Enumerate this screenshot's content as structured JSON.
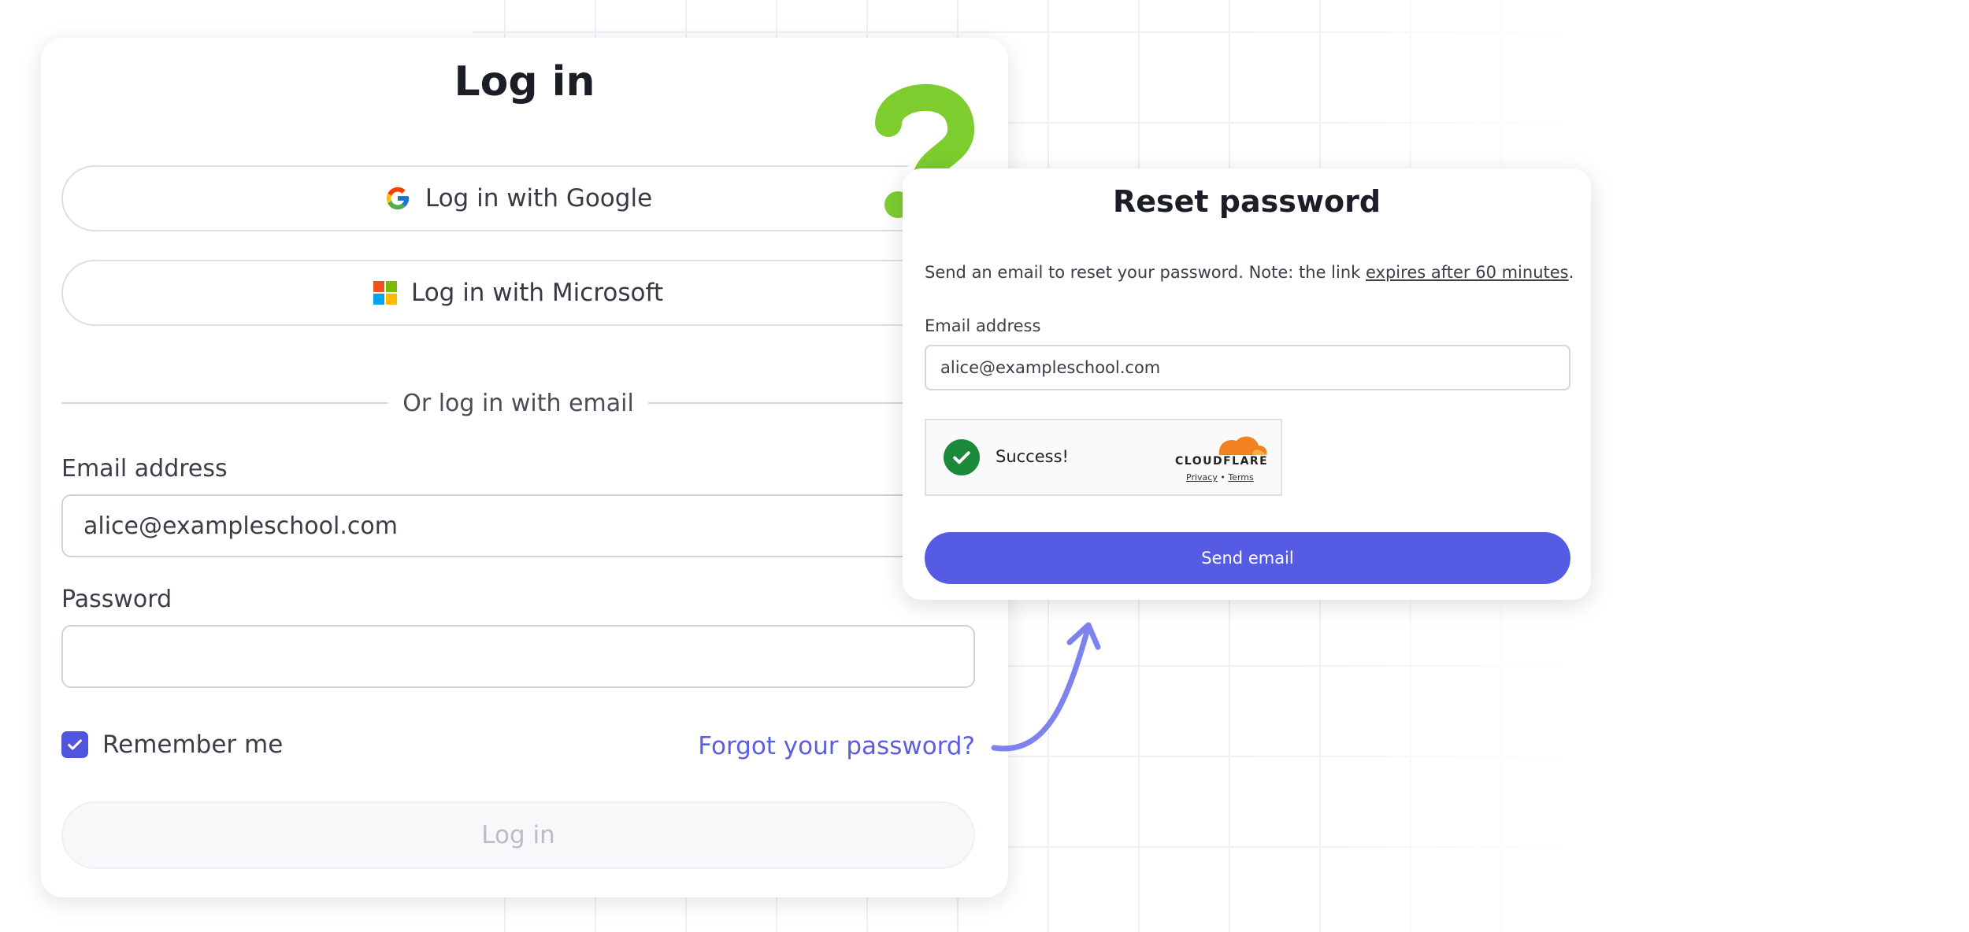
{
  "login": {
    "title": "Log in",
    "google_button": "Log in with Google",
    "microsoft_button": "Log in with Microsoft",
    "divider_text": "Or log in with email",
    "email_label": "Email address",
    "email_value": "alice@exampleschool.com",
    "password_label": "Password",
    "password_value": "",
    "remember_label": "Remember me",
    "remember_checked": true,
    "forgot_link": "Forgot your password?",
    "submit_button": "Log in"
  },
  "reset": {
    "title": "Reset password",
    "description_prefix": "Send an email to reset your password. Note: the link ",
    "description_link": "expires after 60 minutes",
    "description_suffix": ".",
    "email_label": "Email address",
    "email_value": "alice@exampleschool.com",
    "captcha": {
      "status": "Success!",
      "brand": "CLOUDFLARE",
      "privacy": "Privacy",
      "separator": "•",
      "terms": "Terms"
    },
    "send_button": "Send email"
  },
  "colors": {
    "accent": "#555be2",
    "question_mark": "#7dcd2f",
    "success": "#1a8a3a"
  },
  "icons": [
    "google-icon",
    "microsoft-icon",
    "check-icon",
    "cloudflare-icon",
    "question-mark-icon",
    "curved-arrow-icon"
  ]
}
